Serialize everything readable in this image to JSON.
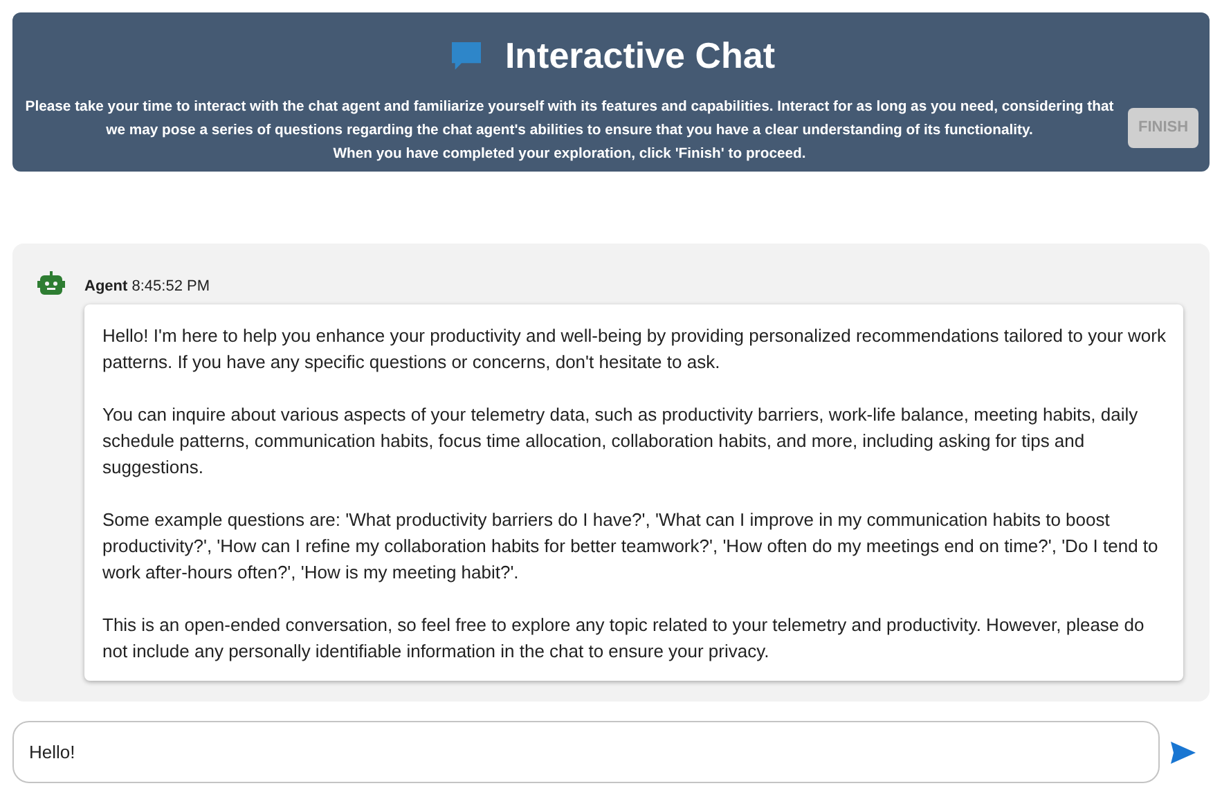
{
  "header": {
    "title": "Interactive Chat",
    "instructions": [
      "Please take your time to interact with the chat agent and familiarize yourself with its features and capabilities. Interact for as long as you need, considering that we may pose a series of questions regarding the chat agent's abilities to ensure that you have a clear understanding of its functionality.",
      "When you have completed your exploration, click 'Finish' to proceed."
    ],
    "finish_button": {
      "label": "FINISH",
      "disabled": true
    }
  },
  "messages": [
    {
      "sender": "Agent",
      "time": "8:45:52 PM",
      "paragraphs": [
        "Hello! I'm here to help you enhance your productivity and well-being by providing personalized recommendations tailored to your work patterns. If you have any specific questions or concerns, don't hesitate to ask.",
        "You can inquire about various aspects of your telemetry data, such as productivity barriers, work-life balance, meeting habits, daily schedule patterns, communication habits, focus time allocation, collaboration habits, and more, including asking for tips and suggestions.",
        "Some example questions are: 'What productivity barriers do I have?', 'What can I improve in my communication habits to boost productivity?', 'How can I refine my collaboration habits for better teamwork?', 'How often do my meetings end on time?', 'Do I tend to work after-hours often?', 'How is my meeting habit?'.",
        "This is an open-ended conversation, so feel free to explore any topic related to your telemetry and productivity. However, please do not include any personally identifiable information in the chat to ensure your privacy."
      ]
    }
  ],
  "composer": {
    "value": "Hello!"
  }
}
